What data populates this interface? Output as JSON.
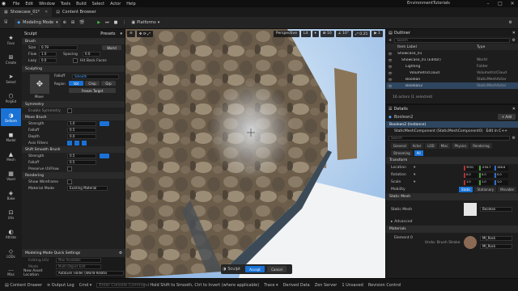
{
  "menubar": {
    "items": [
      "File",
      "Edit",
      "Window",
      "Tools",
      "Build",
      "Select",
      "Actor",
      "Help"
    ],
    "project_name": "EnvironmentTutorials",
    "window_controls": [
      "minimize-icon",
      "maximize-icon",
      "close-icon"
    ]
  },
  "tabs": {
    "level_tab": "Showcase_01*",
    "content_browser_tab": "Content Browser"
  },
  "toolbar": {
    "mode_label": "Modeling Mode",
    "platforms_label": "Platforms"
  },
  "modes": [
    {
      "label": "Favs",
      "icon": "star-icon"
    },
    {
      "label": "Create",
      "icon": "plus-box-icon"
    },
    {
      "label": "Select",
      "icon": "cursor-icon"
    },
    {
      "label": "PolyEd",
      "icon": "polyedit-icon"
    },
    {
      "label": "Deform",
      "icon": "deform-icon",
      "selected": true
    },
    {
      "label": "Model",
      "icon": "cube-icon"
    },
    {
      "label": "Mesh",
      "icon": "mesh-icon"
    },
    {
      "label": "Voxel",
      "icon": "voxel-icon"
    },
    {
      "label": "Bake",
      "icon": "bake-icon"
    },
    {
      "label": "UVs",
      "icon": "uv-icon"
    },
    {
      "label": "Attribs",
      "icon": "attribs-icon"
    },
    {
      "label": "LODs",
      "icon": "lod-icon"
    },
    {
      "label": "Misc",
      "icon": "misc-icon"
    }
  ],
  "sculpt_panel": {
    "title": "Sculpt",
    "presets_label": "Presets",
    "brush_section": "Brush",
    "size_label": "Size",
    "size_value": "0.79",
    "world_label": "World",
    "flow_label": "Flow",
    "flow_value": "1.0",
    "spacing_label": "Spacing",
    "spacing_value": "0.0",
    "lazy_label": "Lazy",
    "lazy_value": "0.0",
    "hit_back_faces_label": "Hit Back Faces",
    "sculpting_section": "Sculpting",
    "falloff_label": "Falloff",
    "falloff_value": "Smooth",
    "move_label": "Move",
    "region_label": "Region",
    "region_options": [
      "Vol",
      "Cmp",
      "Grp"
    ],
    "freeze_target_label": "Freeze Target",
    "symmetry_section": "Symmetry",
    "enable_symmetry_label": "Enable Symmetry",
    "move_brush_section": "Move Brush",
    "strength_label": "Strength",
    "strength_value": "1.0",
    "falloff2_label": "Falloff",
    "falloff2_value": "0.5",
    "depth_label": "Depth",
    "depth_value": "0.0",
    "axis_filters_label": "Axis Filters",
    "shift_smooth_section": "Shift Smooth Brush",
    "smooth_strength_label": "Strength",
    "smooth_strength_value": "0.5",
    "smooth_falloff_label": "Falloff",
    "smooth_falloff_value": "0.5",
    "preserve_uv_label": "Preserve UVFlow",
    "rendering_section": "Rendering",
    "show_wireframe_label": "Show Wireframe",
    "material_mode_label": "Material Mode",
    "material_mode_value": "Existing Material"
  },
  "quick_settings": {
    "title": "Modeling Mode Quick Settings",
    "editing_ugi_label": "Editing UGI",
    "editing_ugi_value": "Max Available",
    "mode_label": "Mode",
    "mode_value": "Multi-Object Edit",
    "asset_location_label": "New Asset Location",
    "asset_location_value": "AutoGen Folder (World-Relativ"
  },
  "viewport": {
    "perspective_label": "Perspective",
    "lit_label": "Lit",
    "accept_label": "Accept",
    "cancel_label": "Cancel",
    "sculpt_label": "Sculpt"
  },
  "outliner": {
    "title": "Outliner",
    "search_placeholder": "Search",
    "col_item_label": "Item Label",
    "col_type": "Type",
    "rows": [
      {
        "label": "Showcase_01",
        "type": "",
        "indent": 0
      },
      {
        "label": "Showcase_01 (Editor)",
        "type": "World",
        "indent": 1
      },
      {
        "label": "Lighting",
        "type": "Folder",
        "indent": 2
      },
      {
        "label": "VolumetricCloud",
        "type": "VolumetricCloud",
        "indent": 3
      },
      {
        "label": "Boolean",
        "type": "StaticMeshActor",
        "indent": 2
      },
      {
        "label": "Boolean2",
        "type": "StaticMeshActor",
        "indent": 2,
        "selected": true
      }
    ],
    "actor_count": "16 actors (1 selected)"
  },
  "details": {
    "title": "Details",
    "object_name": "Boolean2",
    "add_label": "+ Add",
    "instance_label": "Boolean2 (Instance)",
    "component_label": "StaticMeshComponent (StaticMeshComponent0)",
    "edit_in_label": "Edit in C++",
    "search_placeholder": "Search",
    "filter_tabs_row1": [
      "General",
      "Actor",
      "LOD",
      "Misc",
      "Physics",
      "Rendering"
    ],
    "filter_tabs_row2": [
      "Streaming",
      "All"
    ],
    "transform_section": "Transform",
    "location_label": "Location",
    "location_values": [
      "3551",
      "-534.7",
      "188.8"
    ],
    "rotation_label": "Rotation",
    "rotation_values": [
      "0.0",
      "0.0",
      "0.0"
    ],
    "scale_label": "Scale",
    "scale_values": [
      "1.0",
      "1.0",
      "1.0"
    ],
    "mobility_label": "Mobility",
    "mobility_options": [
      "Static",
      "Stationary",
      "Movable"
    ],
    "static_mesh_section": "Static Mesh",
    "static_mesh_label": "Static Mesh",
    "static_mesh_value": "Boolean",
    "advanced_label": "Advanced",
    "materials_section": "Materials",
    "element0_label": "Element 0",
    "element0_value": "MI_Rock",
    "element1_value": "MI_Rock",
    "hint_label": "Undo: Brush Stroke"
  },
  "statusbar": {
    "content_drawer": "Content Drawer",
    "output_log": "Output Log",
    "cmd": "Cmd",
    "console_placeholder": "Enter Console Command",
    "hint": "Hold Shift to Smooth, Ctrl to Invert (where applicable)",
    "trace": "Trace",
    "derived_data": "Derived Data",
    "zen_server": "Zen Server",
    "unsaved": "1 Unsaved",
    "revision_control": "Revision Control"
  }
}
